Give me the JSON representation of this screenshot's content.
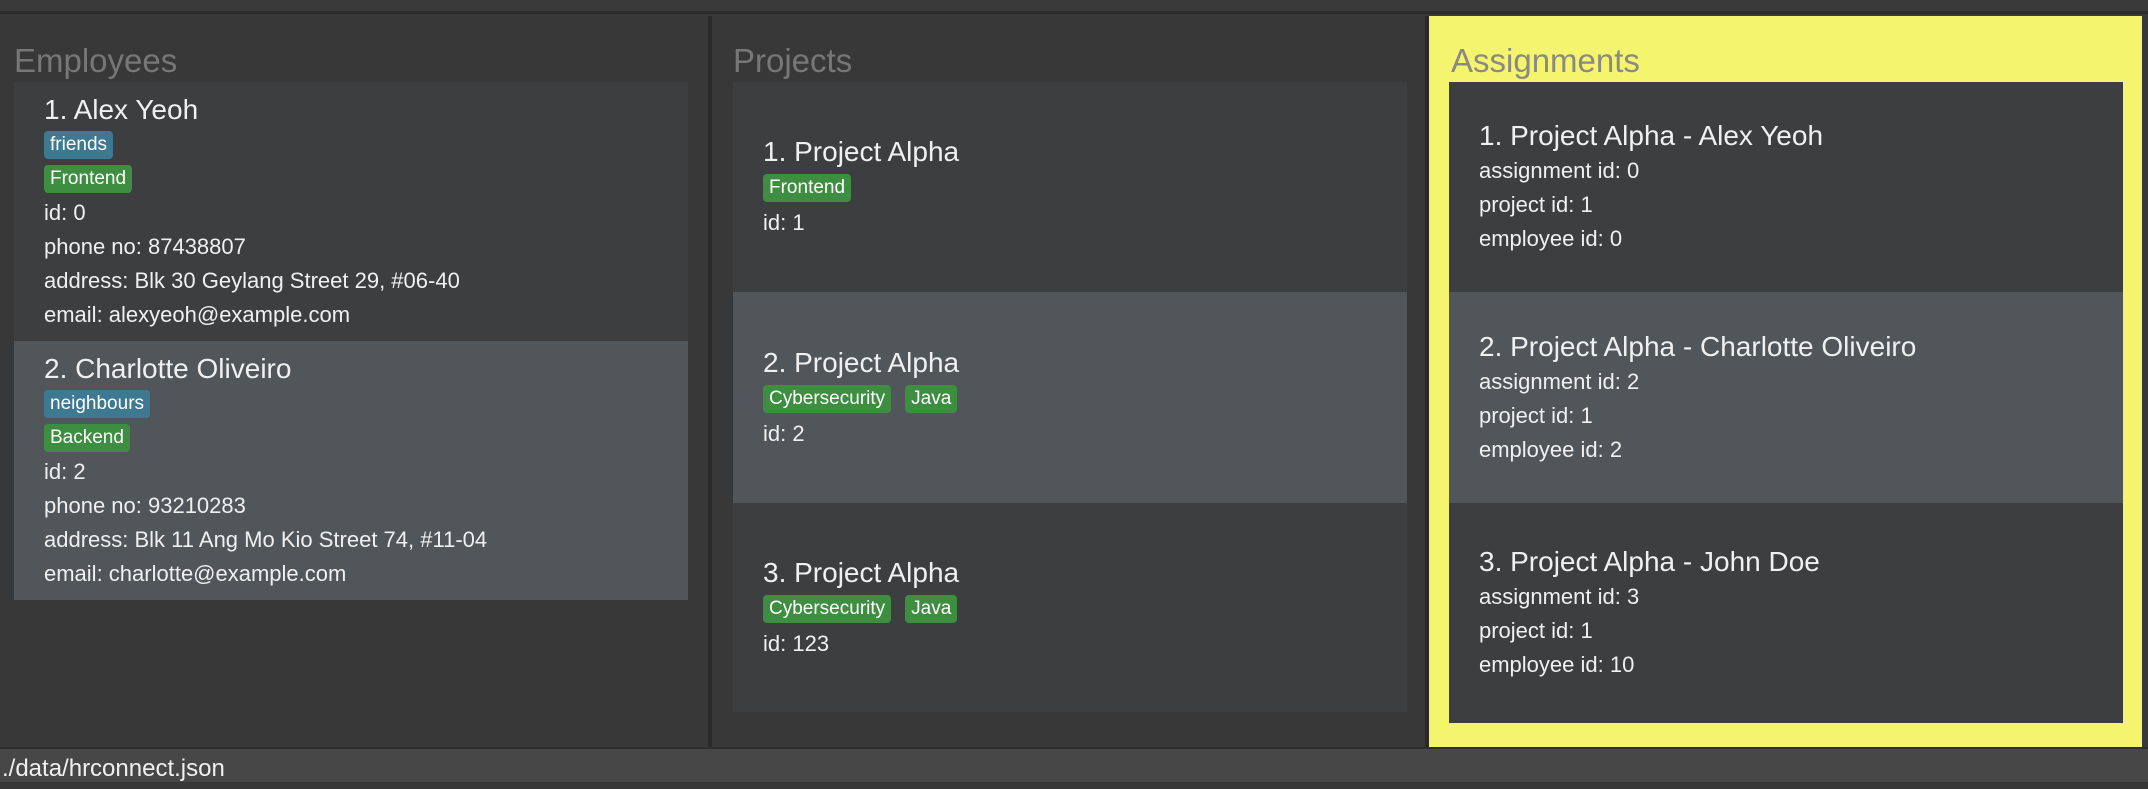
{
  "panels": {
    "employees": {
      "title": "Employees",
      "items": [
        {
          "name": "1. Alex Yeoh",
          "tags": [
            {
              "label": "friends",
              "color": "#3d7a92"
            },
            {
              "label": "Frontend",
              "color": "#3e8e41"
            }
          ],
          "id": "id: 0",
          "phone": "phone no: 87438807",
          "address": "address: Blk 30 Geylang Street 29, #06-40",
          "email": "email: alexyeoh@example.com"
        },
        {
          "name": "2. Charlotte Oliveiro",
          "tags": [
            {
              "label": "neighbours",
              "color": "#3d7a92"
            },
            {
              "label": "Backend",
              "color": "#3e8e41"
            }
          ],
          "id": "id: 2",
          "phone": "phone no: 93210283",
          "address": "address: Blk 11 Ang Mo Kio Street 74, #11-04",
          "email": "email: charlotte@example.com"
        }
      ]
    },
    "projects": {
      "title": "Projects",
      "items": [
        {
          "name": "1. Project Alpha",
          "tags": [
            "Frontend"
          ],
          "id": "id: 1"
        },
        {
          "name": "2. Project Alpha",
          "tags": [
            "Cybersecurity",
            "Java"
          ],
          "id": "id: 2"
        },
        {
          "name": "3. Project Alpha",
          "tags": [
            "Cybersecurity",
            "Java"
          ],
          "id": "id: 123"
        }
      ]
    },
    "assignments": {
      "title": "Assignments",
      "highlight_color": "#f4f46e",
      "items": [
        {
          "name": "1. Project Alpha - Alex Yeoh",
          "assignment_id": "assignment id: 0",
          "project_id": "project id: 1",
          "employee_id": "employee id: 0"
        },
        {
          "name": "2. Project Alpha - Charlotte Oliveiro",
          "assignment_id": "assignment id: 2",
          "project_id": "project id: 1",
          "employee_id": "employee id: 2"
        },
        {
          "name": "3. Project Alpha - John Doe",
          "assignment_id": "assignment id: 3",
          "project_id": "project id: 1",
          "employee_id": "employee id: 10"
        }
      ]
    }
  },
  "status_bar": {
    "file_path": "./data/hrconnect.json"
  }
}
